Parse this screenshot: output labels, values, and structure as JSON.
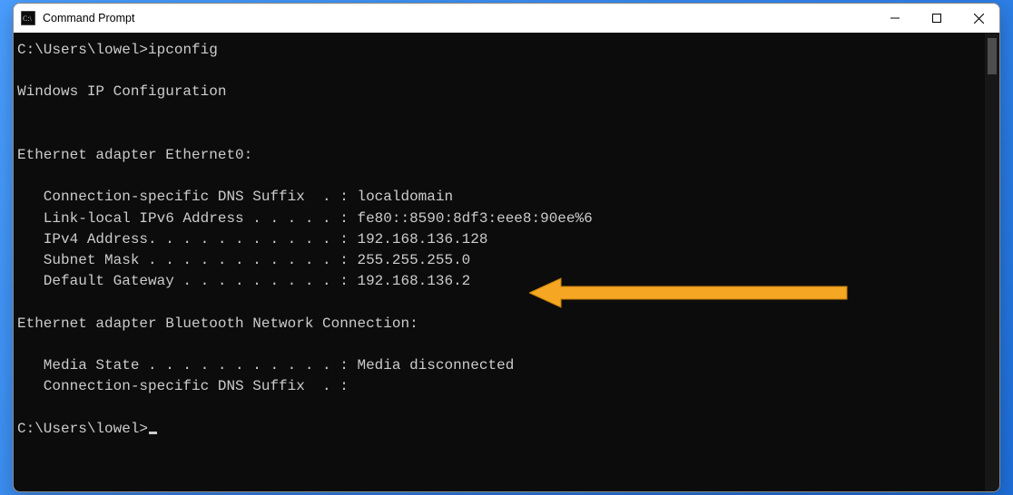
{
  "window": {
    "title": "Command Prompt"
  },
  "terminal": {
    "prompt1": "C:\\Users\\lowel>",
    "command": "ipconfig",
    "blank1": "",
    "header": "Windows IP Configuration",
    "blank2": "",
    "blank3": "",
    "adapter1_title": "Ethernet adapter Ethernet0:",
    "blank4": "",
    "a1_dnssuffix": "   Connection-specific DNS Suffix  . : localdomain",
    "a1_ipv6": "   Link-local IPv6 Address . . . . . : fe80::8590:8df3:eee8:90ee%6",
    "a1_ipv4": "   IPv4 Address. . . . . . . . . . . : 192.168.136.128",
    "a1_mask": "   Subnet Mask . . . . . . . . . . . : 255.255.255.0",
    "a1_gateway": "   Default Gateway . . . . . . . . . : 192.168.136.2",
    "blank5": "",
    "adapter2_title": "Ethernet adapter Bluetooth Network Connection:",
    "blank6": "",
    "a2_media": "   Media State . . . . . . . . . . . : Media disconnected",
    "a2_dnssuffix": "   Connection-specific DNS Suffix  . :",
    "blank7": "",
    "prompt2": "C:\\Users\\lowel>"
  },
  "annotation": {
    "arrow_color": "#f5a623"
  }
}
